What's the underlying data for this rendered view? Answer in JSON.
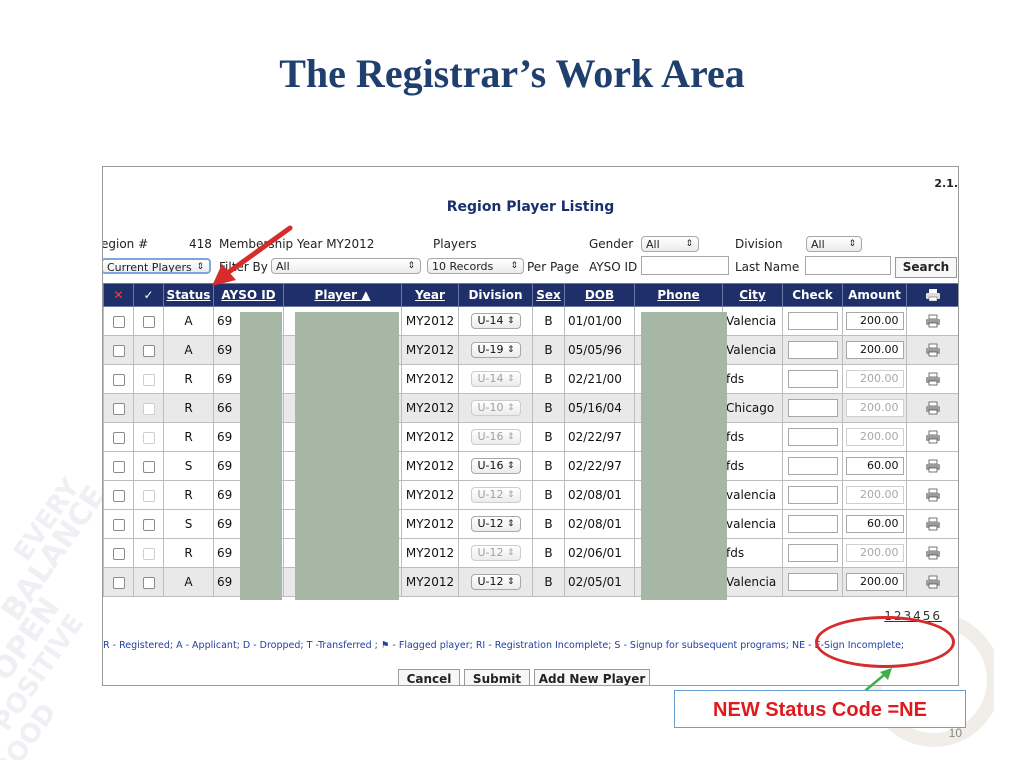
{
  "slide": {
    "title": "The Registrar’s Work Area",
    "callout": "NEW Status Code =NE",
    "page_number": "10"
  },
  "app": {
    "version": "2.1.",
    "title": "Region Player Listing"
  },
  "filters": {
    "region_label": "egion #",
    "region_value": "418",
    "membership_label": "Membership Year MY2012",
    "players_label": "Players",
    "gender_label": "Gender",
    "gender_value": "All",
    "division_label": "Division",
    "division_value": "All",
    "players_select": "Current Players",
    "filter_by_label": "Filter By",
    "filter_by_value": "All",
    "records_value": "10 Records",
    "per_page_label": "Per Page",
    "ayso_id_label": "AYSO ID",
    "last_name_label": "Last Name",
    "search_label": "Search"
  },
  "table": {
    "headers": {
      "delete": "✕",
      "select": "✓",
      "status": "Status",
      "ayso_id": "AYSO ID",
      "player": "Player ▲",
      "year": "Year",
      "division": "Division",
      "sex": "Sex",
      "dob": "DOB",
      "phone": "Phone",
      "city": "City",
      "check": "Check",
      "amount": "Amount"
    },
    "rows": [
      {
        "status": "A",
        "ayso": "69",
        "year": "MY2012",
        "division": "U-14",
        "sex": "B",
        "dob": "01/01/00",
        "city": "Valencia",
        "amount": "200.00"
      },
      {
        "status": "A",
        "ayso": "69",
        "year": "MY2012",
        "division": "U-19",
        "sex": "B",
        "dob": "05/05/96",
        "city": "Valencia",
        "amount": "200.00"
      },
      {
        "status": "R",
        "ayso": "69",
        "year": "MY2012",
        "division": "U-14",
        "sex": "B",
        "dob": "02/21/00",
        "city": "fds",
        "amount": "200.00"
      },
      {
        "status": "R",
        "ayso": "66",
        "year": "MY2012",
        "division": "U-10",
        "sex": "B",
        "dob": "05/16/04",
        "city": "Chicago",
        "amount": "200.00"
      },
      {
        "status": "R",
        "ayso": "69",
        "year": "MY2012",
        "division": "U-16",
        "sex": "B",
        "dob": "02/22/97",
        "city": "fds",
        "amount": "200.00"
      },
      {
        "status": "S",
        "ayso": "69",
        "year": "MY2012",
        "division": "U-16",
        "sex": "B",
        "dob": "02/22/97",
        "city": "fds",
        "amount": "60.00"
      },
      {
        "status": "R",
        "ayso": "69",
        "year": "MY2012",
        "division": "U-12",
        "sex": "B",
        "dob": "02/08/01",
        "city": "valencia",
        "amount": "200.00"
      },
      {
        "status": "S",
        "ayso": "69",
        "year": "MY2012",
        "division": "U-12",
        "sex": "B",
        "dob": "02/08/01",
        "city": "valencia",
        "amount": "60.00"
      },
      {
        "status": "R",
        "ayso": "69",
        "year": "MY2012",
        "division": "U-12",
        "sex": "B",
        "dob": "02/06/01",
        "city": "fds",
        "amount": "200.00"
      },
      {
        "status": "A",
        "ayso": "69",
        "year": "MY2012",
        "division": "U-12",
        "sex": "B",
        "dob": "02/05/01",
        "city": "Valencia",
        "amount": "200.00"
      }
    ]
  },
  "pagination": "123456",
  "legend": "R - Registered; A - Applicant; D - Dropped; T -Transferred ; ⚑ - Flagged player; RI - Registration Incomplete; S - Signup for subsequent programs; NE - E-Sign Incomplete;",
  "buttons": {
    "cancel": "Cancel",
    "submit": "Submit",
    "add_new_player": "Add New Player"
  },
  "colors": {
    "header_bg": "#1f2f6a",
    "title": "#1f3f6e",
    "annotation_red": "#d62c2c",
    "annotation_green": "#3fae4a"
  }
}
